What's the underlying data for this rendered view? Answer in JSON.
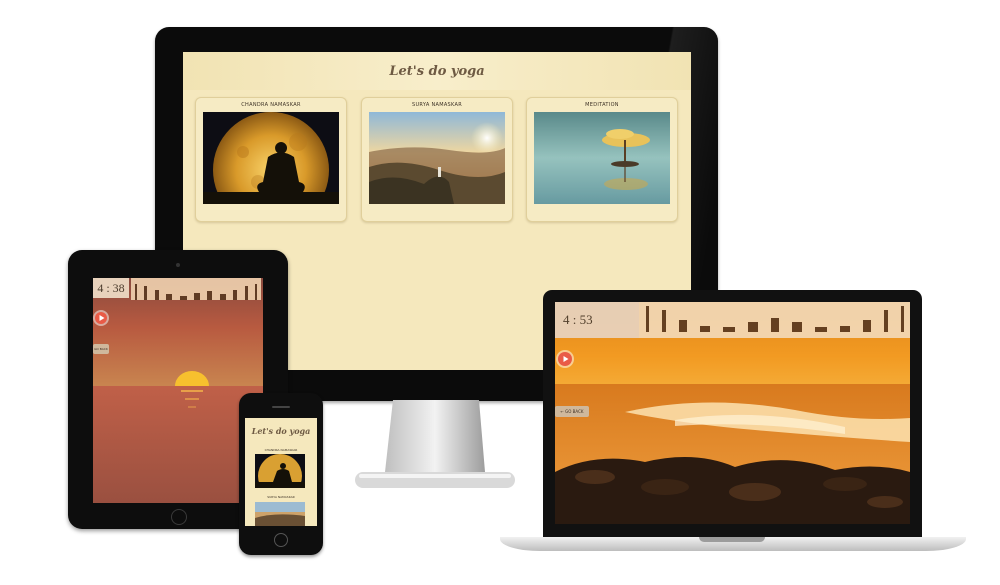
{
  "desktop": {
    "site_title": "Let's do yoga",
    "cards": [
      {
        "label": "CHANDRA NAMASKAR",
        "image": "full-moon-meditation"
      },
      {
        "label": "SURYA NAMASKAR",
        "image": "mountain-sunrise"
      },
      {
        "label": "MEDITATION",
        "image": "lone-tree-reflection"
      }
    ]
  },
  "tablet": {
    "timer": "4 : 38",
    "go_back": "GO BACK",
    "background": "sea-sunset"
  },
  "phone": {
    "site_title": "Let's do yoga",
    "cards": [
      {
        "label": "CHANDRA NAMASKAR"
      },
      {
        "label": "SURYA NAMASKAR"
      }
    ]
  },
  "laptop": {
    "timer": "4 : 53",
    "go_back": "← GO BACK",
    "background": "ocean-wave-sunset"
  },
  "colors": {
    "page_bg": "#f5e8bd",
    "title_text": "#6e5a43",
    "play_button": "#e95b47",
    "timer_bg": "#e8d2bc"
  }
}
